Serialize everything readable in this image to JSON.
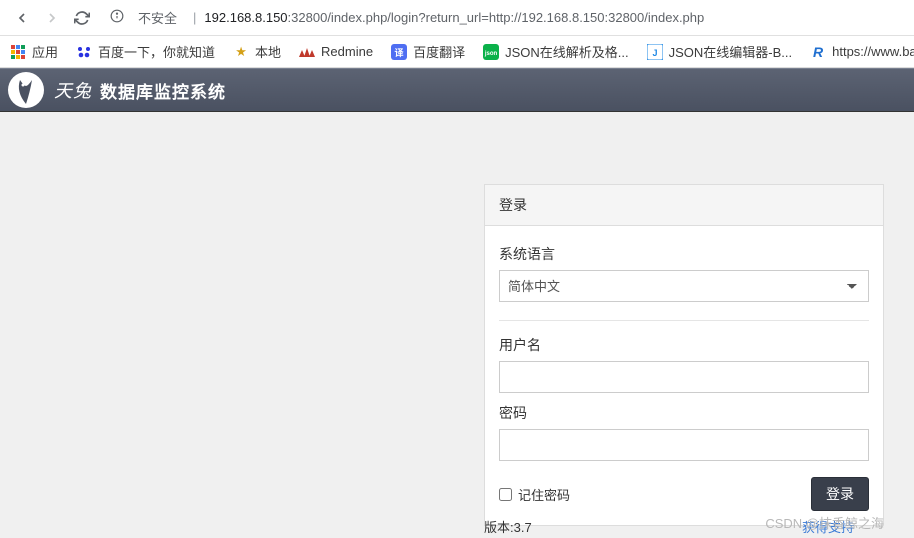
{
  "browser": {
    "insecure_label": "不安全",
    "url_host": "192.168.8.150",
    "url_port": ":32800",
    "url_path": "/index.php/login?return_url=http://192.168.8.150:32800/index.php",
    "bookmarks": {
      "apps": "应用",
      "baidu": "百度一下，你就知道",
      "local": "本地",
      "redmine": "Redmine",
      "fanyi": "百度翻译",
      "json1": "JSON在线解析及格...",
      "json2": "JSON在线编辑器-B...",
      "bd_url": "https://www.baid..."
    }
  },
  "app": {
    "brand1": "天兔",
    "brand2": "数据库监控系统"
  },
  "login": {
    "panel_title": "登录",
    "lang_label": "系统语言",
    "lang_selected": "简体中文",
    "user_label": "用户名",
    "pwd_label": "密码",
    "remember": "记住密码",
    "button": "登录"
  },
  "footer": {
    "version": "版本:3.7",
    "support": "获得支持"
  },
  "watermark": "CSDN @抹香鲸之海"
}
